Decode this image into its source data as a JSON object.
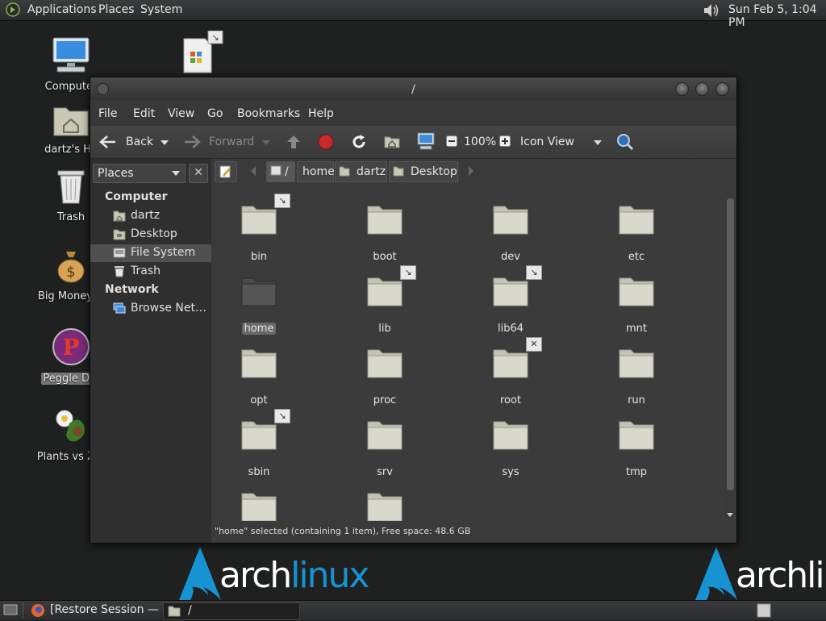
{
  "top_panel": {
    "menus": [
      "Applications",
      "Places",
      "System"
    ],
    "clock": "Sun Feb  5,  1:04 PM"
  },
  "desktop_icons": [
    {
      "label": "Computer"
    },
    {
      "label": "dartz's Ho"
    },
    {
      "label": "Trash"
    },
    {
      "label": "Big Money D"
    },
    {
      "label": "Peggle Del"
    },
    {
      "label": "Plants vs Zor"
    }
  ],
  "brand": {
    "arch": "arch",
    "linux": "linux",
    "arch_right": "archlin",
    "colors": {
      "arch": "#ffffff",
      "linux": "#1793d1"
    }
  },
  "window": {
    "title": "/",
    "menu": [
      "File",
      "Edit",
      "View",
      "Go",
      "Bookmarks",
      "Help"
    ],
    "toolbar": {
      "back": "Back",
      "forward": "Forward",
      "zoom": "100%",
      "view_mode": "Icon View"
    },
    "sidebar": {
      "combo": "Places",
      "close": "✕",
      "sections": [
        {
          "heading": "Computer",
          "items": [
            "dartz",
            "Desktop",
            "File System",
            "Trash"
          ]
        },
        {
          "heading": "Network",
          "items": [
            "Browse Net…"
          ]
        }
      ],
      "selected": "File System"
    },
    "path": [
      "/",
      "home",
      "dartz",
      "Desktop"
    ],
    "files": [
      {
        "name": "bin",
        "emblem": "link"
      },
      {
        "name": "boot",
        "emblem": ""
      },
      {
        "name": "dev",
        "emblem": ""
      },
      {
        "name": "etc",
        "emblem": ""
      },
      {
        "name": "home",
        "emblem": "",
        "selected": true
      },
      {
        "name": "lib",
        "emblem": "link"
      },
      {
        "name": "lib64",
        "emblem": "link"
      },
      {
        "name": "mnt",
        "emblem": ""
      },
      {
        "name": "opt",
        "emblem": ""
      },
      {
        "name": "proc",
        "emblem": ""
      },
      {
        "name": "root",
        "emblem": "noaccess"
      },
      {
        "name": "run",
        "emblem": ""
      },
      {
        "name": "sbin",
        "emblem": "link"
      },
      {
        "name": "srv",
        "emblem": ""
      },
      {
        "name": "sys",
        "emblem": ""
      },
      {
        "name": "tmp",
        "emblem": ""
      },
      {
        "name": "",
        "emblem": ""
      },
      {
        "name": "",
        "emblem": ""
      }
    ],
    "status": "\"home\" selected (containing 1 item), Free space: 48.6 GB"
  },
  "taskbar": {
    "tasks": [
      "[Restore Session — …",
      "/"
    ]
  },
  "icons": {
    "link": "↘",
    "noaccess": "✕"
  }
}
